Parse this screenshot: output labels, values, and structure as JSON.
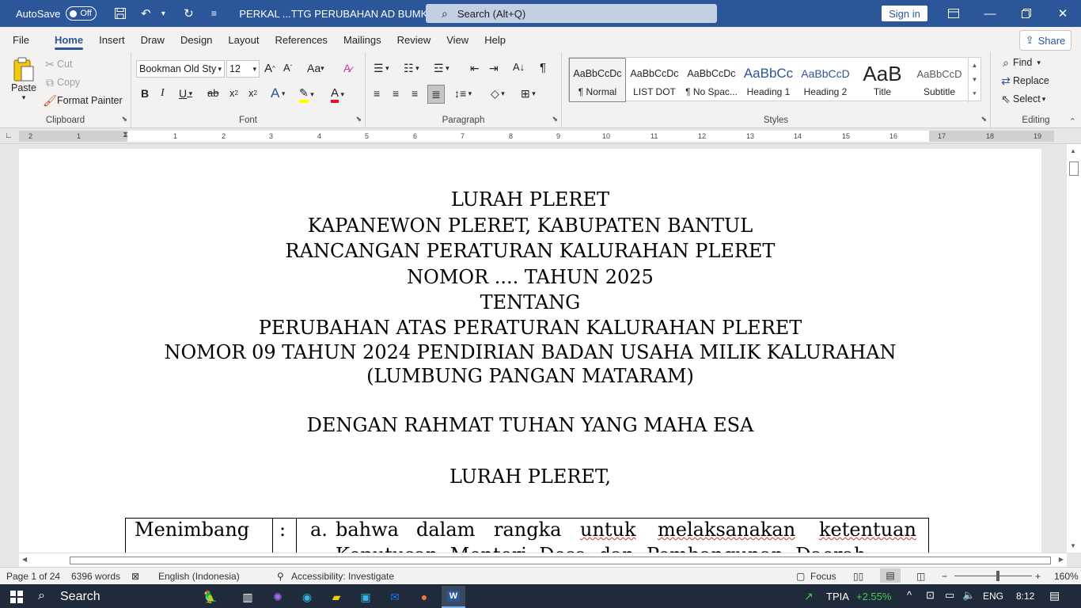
{
  "titlebar": {
    "autosave_label": "AutoSave",
    "autosave_state": "Off",
    "doc_title": "PERKAL ...TTG PERUBAHAN AD BUMKAL  -  Word",
    "search_placeholder": "Search (Alt+Q)",
    "signin_label": "Sign in"
  },
  "tabs": [
    "File",
    "Home",
    "Insert",
    "Draw",
    "Design",
    "Layout",
    "References",
    "Mailings",
    "Review",
    "View",
    "Help"
  ],
  "share_label": "Share",
  "ribbon": {
    "clipboard": {
      "label": "Clipboard",
      "paste": "Paste",
      "cut": "Cut",
      "copy": "Copy",
      "format_painter": "Format Painter"
    },
    "font": {
      "label": "Font",
      "font_name": "Bookman Old Sty",
      "font_size": "12"
    },
    "paragraph": {
      "label": "Paragraph"
    },
    "styles": {
      "label": "Styles",
      "items": [
        {
          "preview": "AaBbCcDc",
          "name": "¶ Normal"
        },
        {
          "preview": "AaBbCcDc",
          "name": "LIST DOT"
        },
        {
          "preview": "AaBbCcDc",
          "name": "¶ No Spac..."
        },
        {
          "preview": "AaBbCc",
          "name": "Heading 1"
        },
        {
          "preview": "AaBbCcD",
          "name": "Heading 2"
        },
        {
          "preview": "AaB",
          "name": "Title"
        },
        {
          "preview": "AaBbCcD",
          "name": "Subtitle"
        }
      ]
    },
    "editing": {
      "label": "Editing",
      "find": "Find",
      "replace": "Replace",
      "select": "Select"
    }
  },
  "ruler_numbers": [
    "2",
    "1",
    "1",
    "2",
    "3",
    "4",
    "5",
    "6",
    "7",
    "8",
    "9",
    "10",
    "11",
    "12",
    "13",
    "14",
    "15",
    "16",
    "17",
    "18",
    "19"
  ],
  "document": {
    "lines": [
      "LURAH PLERET",
      "KAPANEWON PLERET, KABUPATEN BANTUL",
      "RANCANGAN PERATURAN KALURAHAN PLERET",
      "NOMOR .... TAHUN 2025",
      "TENTANG",
      "PERUBAHAN ATAS PERATURAN KALURAHAN PLERET",
      "NOMOR 09 TAHUN 2024 PENDIRIAN BADAN USAHA MILIK KALURAHAN",
      "(LUMBUNG PANGAN MATARAM)",
      "DENGAN RAHMAT TUHAN YANG MAHA ESA",
      "LURAH PLERET,"
    ],
    "table": {
      "label": "Menimbang",
      "colon": ":",
      "item_letter": "a.",
      "line1_words": [
        "bahwa",
        "dalam",
        "rangka",
        "untuk",
        "melaksanakan",
        "ketentuan"
      ],
      "line2": "Keputusan  Menteri  Desa  dan  Pembangunan  Daerah"
    }
  },
  "status": {
    "page": "Page 1 of 24",
    "words": "6396 words",
    "language": "English (Indonesia)",
    "accessibility": "Accessibility: Investigate",
    "focus": "Focus",
    "zoom": "160%"
  },
  "taskbar": {
    "search": "Search",
    "stock_name": "TPIA",
    "stock_change": "+2.55%",
    "lang": "ENG",
    "time": "8:12"
  }
}
